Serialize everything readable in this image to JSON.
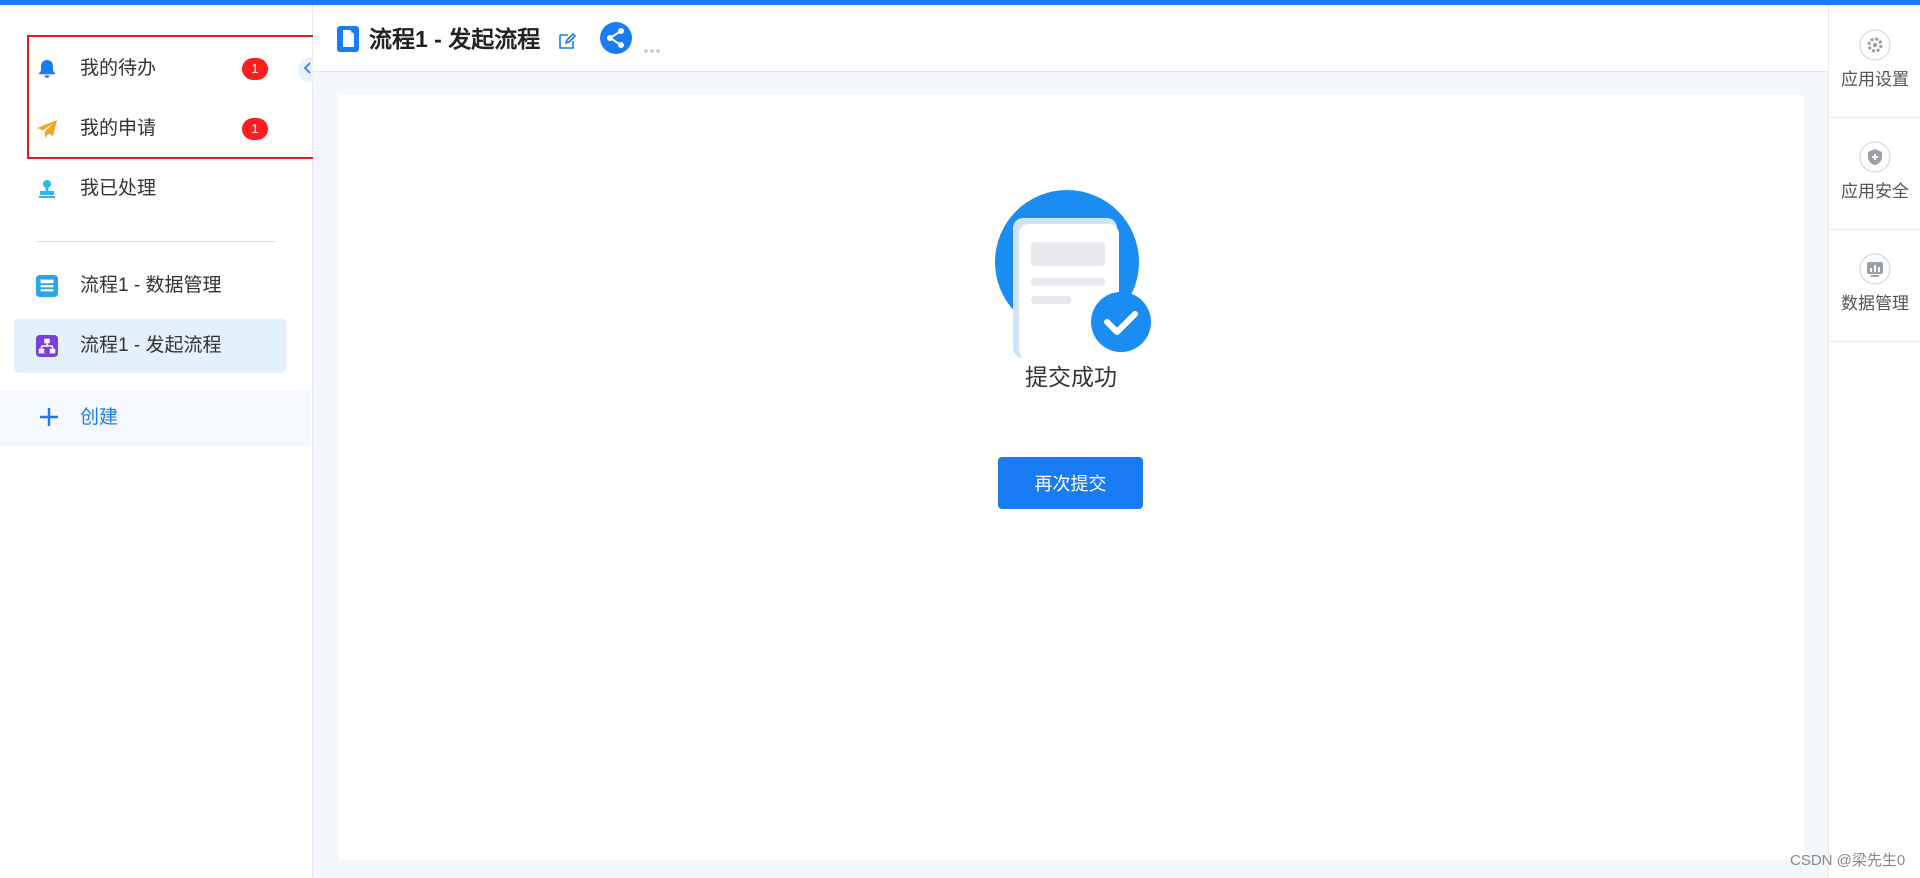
{
  "sidebar": {
    "items": [
      {
        "label": "我的待办",
        "badge": "1",
        "icon": "bell-icon"
      },
      {
        "label": "我的申请",
        "badge": "1",
        "icon": "paper-plane-icon"
      },
      {
        "label": "我已处理",
        "icon": "stamp-icon"
      },
      {
        "label": "流程1 - 数据管理",
        "icon": "data-table-icon"
      },
      {
        "label": "流程1 - 发起流程",
        "icon": "flow-chart-icon",
        "active": true
      }
    ],
    "create_label": "创建"
  },
  "header": {
    "title": "流程1 - 发起流程"
  },
  "main": {
    "success_text": "提交成功",
    "resubmit_label": "再次提交"
  },
  "right_rail": {
    "items": [
      {
        "label": "应用设置",
        "icon": "gear-icon"
      },
      {
        "label": "应用安全",
        "icon": "shield-icon"
      },
      {
        "label": "数据管理",
        "icon": "data-chart-icon"
      }
    ]
  },
  "watermark": "CSDN @梁先生0",
  "colors": {
    "accent": "#1a7cf5",
    "badge": "#ff1e1e",
    "highlight": "#e01c1c"
  }
}
